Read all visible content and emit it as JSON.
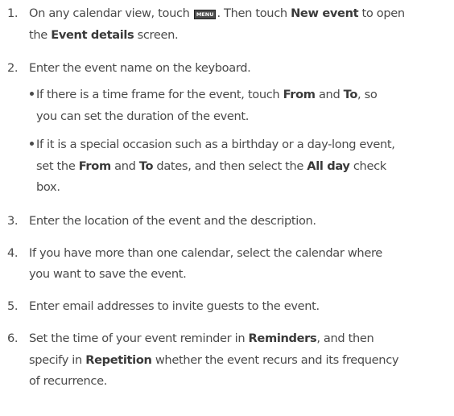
{
  "steps": [
    {
      "number": "1.",
      "line1_pre": "On any calendar view, touch ",
      "menu_key": "MENU",
      "line1_mid": ". Then touch ",
      "line1_bold": "New event",
      "line1_post": " to open",
      "line2_pre": "the ",
      "line2_bold": "Event details",
      "line2_post": " screen."
    },
    {
      "number": "2.",
      "text": "Enter the event name on the keyboard.",
      "bullets": [
        {
          "line1_pre": "If there is a time frame for the event, touch ",
          "line1_bold1": "From",
          "line1_mid": " and ",
          "line1_bold2": "To",
          "line1_post": ", so",
          "line2": "you can set the duration of the event."
        },
        {
          "line1": "If it is a special occasion such as a birthday or a day-long event,",
          "line2_pre": "set the ",
          "line2_bold1": "From",
          "line2_mid1": " and ",
          "line2_bold2": "To",
          "line2_mid2": " dates, and then select the ",
          "line2_bold3": "All day",
          "line2_post": " check",
          "line3": "box."
        }
      ]
    },
    {
      "number": "3.",
      "text": "Enter the location of the event and the description."
    },
    {
      "number": "4.",
      "line1": "If you have more than one calendar, select the calendar where",
      "line2": "you want to save the event."
    },
    {
      "number": "5.",
      "text": "Enter email addresses to invite guests to the event."
    },
    {
      "number": "6.",
      "line1_pre": "Set the time of your event reminder in ",
      "line1_bold": "Reminders",
      "line1_post": ", and then",
      "line2_pre": "specify in ",
      "line2_bold": "Repetition",
      "line2_post": " whether the event recurs and its frequency",
      "line3": "of recurrence."
    }
  ]
}
